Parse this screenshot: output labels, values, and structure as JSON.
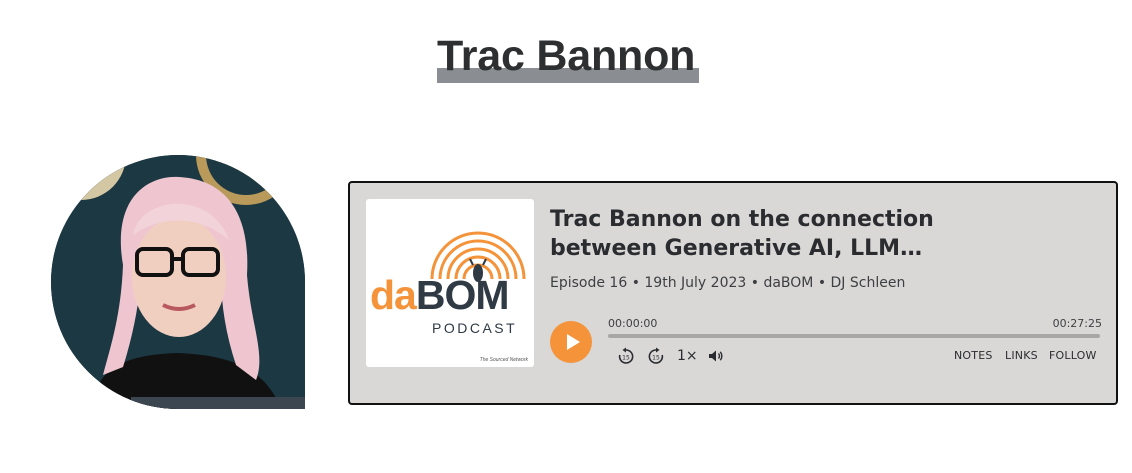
{
  "page": {
    "title": "Trac Bannon"
  },
  "player": {
    "artwork": {
      "brand_da": "da",
      "brand_bom": "BOM",
      "subtitle": "PODCAST",
      "network": "The Sourced Network"
    },
    "episode_title": "Trac Bannon on the connection between Generative AI, LLM and…",
    "episode_meta": "Episode 16 • 19th July 2023 • daBOM • DJ Schleen",
    "current_time": "00:00:00",
    "duration": "00:27:25",
    "progress": 0,
    "speed": "1×",
    "skip_back_seconds": "15",
    "skip_forward_seconds": "15",
    "links": {
      "notes": "NOTES",
      "links": "LINKS",
      "follow": "FOLLOW"
    },
    "colors": {
      "accent": "#f4933a",
      "background": "#d9d8d7",
      "text": "#2a2c30"
    },
    "icons": [
      "play-icon",
      "skip-back-15-icon",
      "skip-forward-15-icon",
      "volume-icon"
    ]
  }
}
